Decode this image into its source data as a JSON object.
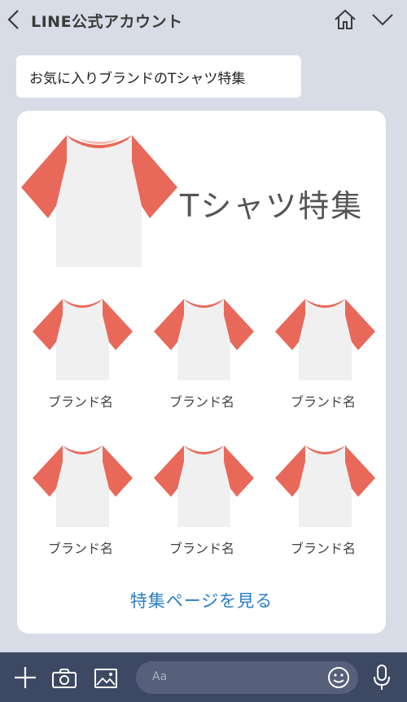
{
  "header": {
    "title": "LINE公式アカウント"
  },
  "message": {
    "text": "お気に入りブランドのTシャツ特集"
  },
  "card": {
    "hero_title": "Tシャツ特集",
    "items": [
      {
        "brand": "ブランド名"
      },
      {
        "brand": "ブランド名"
      },
      {
        "brand": "ブランド名"
      },
      {
        "brand": "ブランド名"
      },
      {
        "brand": "ブランド名"
      },
      {
        "brand": "ブランド名"
      }
    ],
    "more_link": "特集ページを見る",
    "colors": {
      "sleeve": "#e8695a",
      "body": "#f0f0f0"
    }
  },
  "input": {
    "placeholder": "Aa"
  },
  "icons": [
    "back-icon",
    "home-icon",
    "chevron-down-icon",
    "plus-icon",
    "camera-icon",
    "image-icon",
    "emoji-icon",
    "microphone-icon"
  ]
}
